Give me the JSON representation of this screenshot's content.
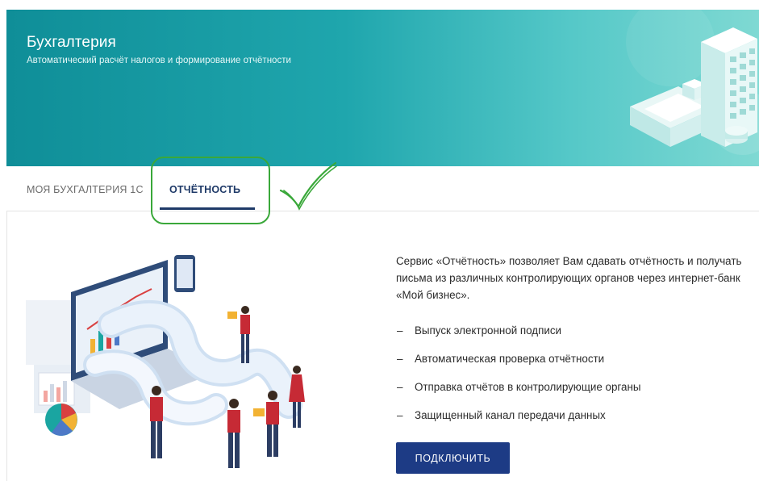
{
  "banner": {
    "title": "Бухгалтерия",
    "subtitle": "Автоматический расчёт налогов и формирование отчётности",
    "art_icon": "calculator-icon"
  },
  "tabs": [
    {
      "label": "МОЯ БУХГАЛТЕРИЯ 1С",
      "active": false
    },
    {
      "label": "ОТЧЁТНОСТЬ",
      "active": true
    }
  ],
  "annotation": {
    "highlight_color": "#3aa83a",
    "check_icon": "checkmark-icon"
  },
  "content": {
    "description": "Сервис «Отчётность» позволяет Вам сдавать отчётность и получать письма из различных контролирующих органов через интернет-банк «Мой бизнес».",
    "dash": "–",
    "features": [
      "Выпуск электронной подписи",
      "Автоматическая проверка отчётности",
      "Отправка отчётов в контролирующие органы",
      "Защищенный канал передачи данных"
    ],
    "connect_label": "ПОДКЛЮЧИТЬ"
  },
  "colors": {
    "banner_start": "#0f8e98",
    "banner_end": "#7fd9d3",
    "active_tab": "#1f3a68",
    "button": "#1d3b85"
  }
}
